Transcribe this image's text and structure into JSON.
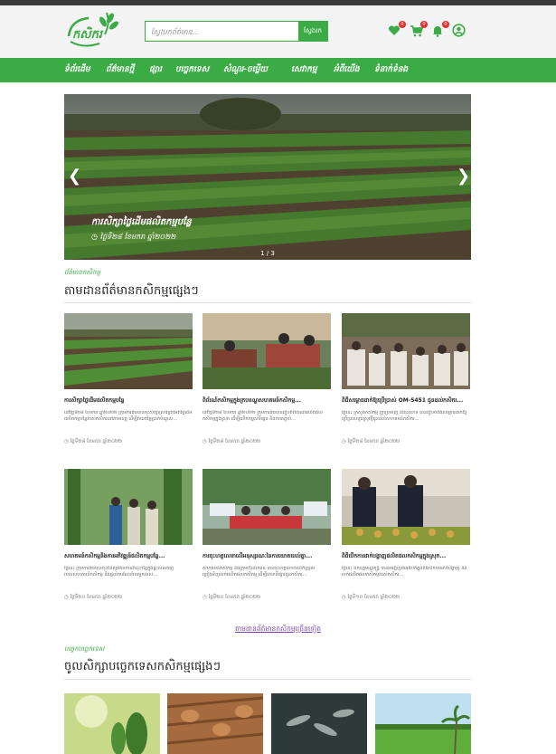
{
  "header": {
    "logo_text": "កសិករ",
    "search_placeholder": "ស្វែងរកព័ត៌មាន...",
    "search_button": "ស្វែងរក",
    "wishlist_count": "0",
    "cart_count": "0",
    "notify_count": "0"
  },
  "nav": [
    "ទំព័រដើម",
    "ព័ត៌មានថ្មី",
    "ផ្សារ",
    "បច្ចេកទេស",
    "សំណួរ-ចម្លើយ",
    "សេវាកម្ម",
    "អំពីយើង",
    "ទំនាក់ទំនង"
  ],
  "hero": {
    "title": "ការសិក្សាថ្លៃដើមផលិតកម្មបន្លែ",
    "date": "ថ្ងៃទី២៨ ខែមករា ឆ្នាំ២០២២",
    "pager": "1 / 3"
  },
  "news_section": {
    "label": "ព័ត៌មានកសិកម្ម",
    "title": "តាមដានព័ត៌មានកសិកម្មផ្សេងៗ",
    "more": "តាមដានព័ត៌មានកសិកម្មច្រើនទៀត"
  },
  "news": [
    {
      "title": "ការសិក្សាថ្លៃដើមផលិតកម្មបន្លែ",
      "desc": "នៅថ្ងៃទី២៨ ខែមករា ឆ្នាំ២០២២ ក្រុមការងារបានចុះសិក្សាស្រាវជ្រាវអំពីថ្លៃដើមផលិតកម្មបន្លែរបស់កសិករនៅតាមខេត្ត ដើម្បីវាយតម្លៃប្រាក់ចំណូល...",
      "date": "ថ្ងៃទី២៨ ខែមករា ឆ្នាំ២០២២"
    },
    {
      "title": "ពិព័រណ៍កសិកម្មក្នុងក្របខណ្ឌសហគមន៍កសិកម្ម...",
      "desc": "នៅថ្ងៃទី២៨ ខែមករា ឆ្នាំ២០២២ ក្រុមការងារបានរៀបចំពិព័រណ៍ផលិតផលកសិកម្មក្នុងស្រុក ដើម្បីលើកកម្ពស់ទីផ្សារ និងការតភ្ជាប់...",
      "date": "ថ្ងៃទី២៨ ខែមករា ឆ្នាំ២០២២"
    },
    {
      "title": "ពិធីសម្ពោធដាក់ឱ្យប្រើប្រាស់ OM-5451 ជូនដល់កសិករ...",
      "desc": "ថ្ងៃនេះ ក្រសួងកសិកម្ម រុក្ខាប្រមាញ់ និងនេសាទ បានរៀបចំពិធីសម្ពោធដាក់ឱ្យប្រើប្រាស់ពូជស្រូវថ្មីជូនដល់សហគមន៍កសិករ...",
      "date": "ថ្ងៃទី២៨ ខែមករា ឆ្នាំ២០២២"
    },
    {
      "title": "សហគមន៍កសិកម្មនិងការអភិវឌ្ឍន៍ផលិតកម្មបន្លែ...",
      "desc": "ថ្ងៃនេះ ក្រុមការងារបានចុះពិនិត្យមើលការដាំដុះបន្លែក្នុងផ្ទះសំណាញ់របស់សហគមន៍កសិកម្ម និងផ្ដល់ការណែនាំបច្ចេកទេស...",
      "date": "ថ្ងៃទី២០ ខែមករា ឆ្នាំ២០២២"
    },
    {
      "title": "ការចុះហត្ថលេខាលើអនុស្សរណៈនៃការយោគយល់គ្នា...",
      "desc": "សហគមន៍កសិកម្ម និងក្រុមហ៊ុនឯកជន បានចុះហត្ថលេខាលើកិច្ចព្រមព្រៀងទិញលក់ផលិតផលកសិកម្ម ដើម្បីធានាទីផ្សារជូនកសិករ...",
      "date": "ថ្ងៃទី២០ ខែមករា ឆ្នាំ២០២២"
    },
    {
      "title": "ពិធីបើកការដាក់បង្ហាញផលិតផលកសិកម្មក្នុងស្រុក...",
      "desc": "ថ្ងៃនេះ ឯកឧត្តមរដ្ឋមន្ត្រី បានអញ្ជើញជាអធិបតីក្នុងពិធីបើកការដាក់បង្ហាញ និងលក់ផលិតផលកសិកម្មរបស់កសិករ...",
      "date": "ថ្ងៃទី១០ ខែមករា ឆ្នាំ២០២២"
    }
  ],
  "tech_section": {
    "label": "បច្ចេកបច្ចេកទេស",
    "title": "ចូលសិក្សាបច្ចេកទេសកសិកម្មផ្សេងៗ"
  },
  "colors": {
    "brand": "#3bab45",
    "link": "#7b3fb3",
    "badge": "#e53030"
  }
}
